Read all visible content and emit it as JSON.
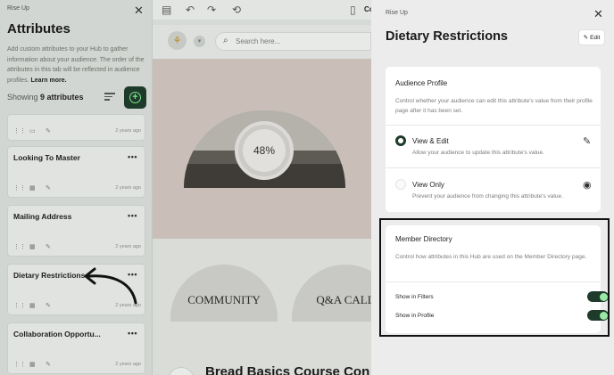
{
  "left": {
    "brand": "Rise Up",
    "title": "Attributes",
    "description": "Add custom attributes to your Hub to gather information about your audience. The order of the attributes in this tab will be reflected in audience profiles.",
    "learn_more": "Learn more.",
    "showing_prefix": "Showing",
    "showing_count": "9 attributes",
    "cards": [
      {
        "title": "",
        "ago": "2 years ago"
      },
      {
        "title": "Looking To Master",
        "ago": "2 years ago"
      },
      {
        "title": "Mailing Address",
        "ago": "2 years ago"
      },
      {
        "title": "Dietary Restrictions",
        "ago": "2 years ago"
      },
      {
        "title": "Collaboration Opportu...",
        "ago": "2 years ago"
      }
    ]
  },
  "mid": {
    "toolbar_cut": "Co",
    "search_placeholder": "Search here...",
    "progress": "48%",
    "progress_value": 48,
    "tiles": [
      "COMMUNITY",
      "Q&A CALL"
    ],
    "course_title": "Bread Basics Course Con"
  },
  "right": {
    "brand": "Rise Up",
    "title": "Dietary Restrictions",
    "edit_label": "Edit",
    "audience": {
      "title": "Audience Profile",
      "description": "Control whether your audience can edit this attribute's value from their profile page after it has been set.",
      "options": [
        {
          "label": "View & Edit",
          "sub": "Allow your audience to update this attribute's value.",
          "selected": true,
          "icon": "pencil-icon"
        },
        {
          "label": "View Only",
          "sub": "Prevent your audience from changing this attribute's value.",
          "selected": false,
          "icon": "eye-icon"
        }
      ]
    },
    "directory": {
      "title": "Member Directory",
      "description": "Control how attributes in this Hub are used on the Member Directory page.",
      "toggles": [
        {
          "label": "Show in Filters",
          "on": true
        },
        {
          "label": "Show in Profile",
          "on": true
        }
      ]
    }
  },
  "colors": {
    "accent_dark": "#1e3a2a",
    "accent_green": "#7be68e"
  }
}
